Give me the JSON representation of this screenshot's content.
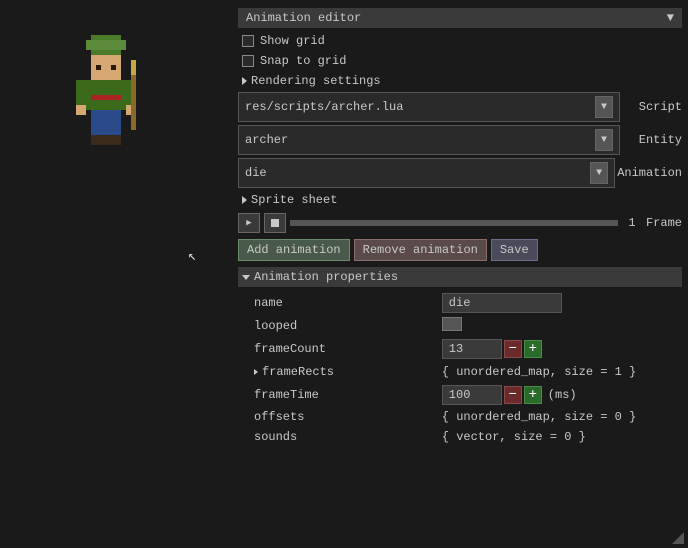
{
  "header": {
    "title": "Animation editor",
    "dropdown_arrow": "▼"
  },
  "checkboxes": {
    "show_grid": "Show grid",
    "snap_to_grid": "Snap to grid"
  },
  "rendering_settings": "Rendering settings",
  "selects": {
    "script": {
      "value": "res/scripts/archer.lua",
      "label": "Script"
    },
    "entity": {
      "value": "archer",
      "label": "Entity"
    },
    "animation": {
      "value": "die",
      "label": "Animation"
    }
  },
  "sprite_sheet": "Sprite sheet",
  "frame": {
    "label": "Frame",
    "value": "1"
  },
  "buttons": {
    "add_animation": "Add animation",
    "remove_animation": "Remove animation",
    "save": "Save"
  },
  "animation_properties": {
    "title": "Animation properties",
    "props": {
      "name": {
        "label": "name",
        "value": "die"
      },
      "looped": {
        "label": "looped"
      },
      "frameCount": {
        "label": "frameCount",
        "value": "13"
      },
      "frameRects": {
        "label": "frameRects",
        "value": "{ unordered_map, size = 1 }"
      },
      "frameTime": {
        "label": "frameTime",
        "value": "100",
        "unit": "(ms)"
      },
      "offsets": {
        "label": "offsets",
        "value": "{ unordered_map, size = 0 }"
      },
      "sounds": {
        "label": "sounds",
        "value": "{ vector, size = 0 }"
      }
    }
  },
  "icons": {
    "play": "▶",
    "stop": "■",
    "minus": "−",
    "plus": "+"
  }
}
